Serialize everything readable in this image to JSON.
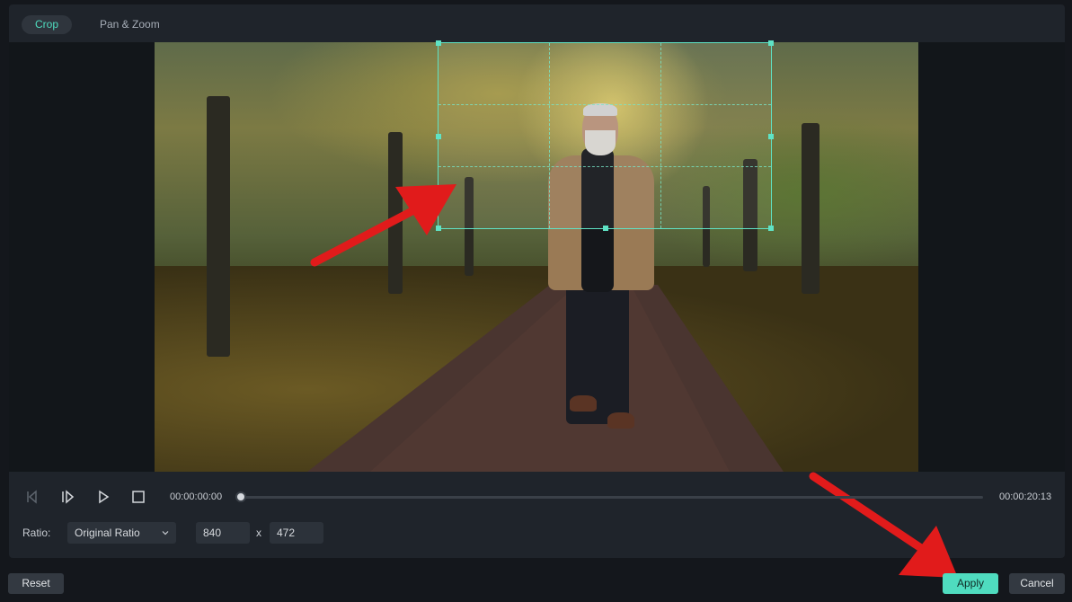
{
  "tabs": [
    {
      "label": "Crop",
      "active": true
    },
    {
      "label": "Pan & Zoom",
      "active": false
    }
  ],
  "playback": {
    "current_time": "00:00:00:00",
    "total_time": "00:00:20:13",
    "progress": 0.0,
    "buttons": [
      "prev-frame-icon",
      "next-frame-icon",
      "play-icon",
      "stop-icon"
    ]
  },
  "ratio": {
    "label": "Ratio:",
    "selected": "Original Ratio",
    "width": "840",
    "separator": "x",
    "height": "472"
  },
  "footer": {
    "reset_label": "Reset",
    "apply_label": "Apply",
    "cancel_label": "Cancel"
  },
  "colors": {
    "accent": "#4fdcbf",
    "annotation_arrow": "#e11b1b"
  }
}
